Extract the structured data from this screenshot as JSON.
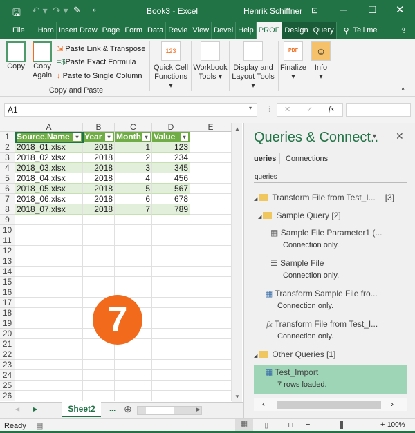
{
  "title": {
    "doc": "Book3  -  Excel",
    "user": "Henrik Schiffner"
  },
  "tabs": [
    "File",
    "Hom",
    "Insert",
    "Draw",
    "Page",
    "Form",
    "Data",
    "Revie",
    "View",
    "Devel",
    "Help",
    "PROF",
    "Design",
    "Query"
  ],
  "tell_me": "Tell me",
  "ribbon": {
    "copy": "Copy",
    "copy_again_1": "Copy",
    "copy_again_2": "Again",
    "paste_link": "Paste Link & Transpose",
    "paste_exact": "Paste Exact Formula",
    "paste_single": "Paste to Single Column",
    "group": "Copy and Paste",
    "quick1": "Quick Cell",
    "quick2": "Functions ▾",
    "wb1": "Workbook",
    "wb2": "Tools ▾",
    "disp1": "Display and",
    "disp2": "Layout Tools ▾",
    "finalize": "Finalize",
    "info": "Info",
    "pdf": "PDF",
    "quick_icon": "123"
  },
  "namebox": "A1",
  "fx": "fx",
  "grid": {
    "columns": [
      "A",
      "B",
      "C",
      "D",
      "E"
    ],
    "headers": [
      "Source.Name",
      "Year",
      "Month",
      "Value"
    ],
    "rows": [
      [
        "2018_01.xlsx",
        "2018",
        "1",
        "123"
      ],
      [
        "2018_02.xlsx",
        "2018",
        "2",
        "234"
      ],
      [
        "2018_03.xlsx",
        "2018",
        "3",
        "345"
      ],
      [
        "2018_04.xlsx",
        "2018",
        "4",
        "456"
      ],
      [
        "2018_05.xlsx",
        "2018",
        "5",
        "567"
      ],
      [
        "2018_06.xlsx",
        "2018",
        "6",
        "678"
      ],
      [
        "2018_07.xlsx",
        "2018",
        "7",
        "789"
      ]
    ],
    "row_count": 26
  },
  "badge": "7",
  "pane": {
    "title": "Queries & Connect..",
    "tab_queries": "ueries",
    "tab_connections": "Connections",
    "subheader": "queries",
    "g1": "Transform File from Test_I...",
    "g1_count": "[3]",
    "g2": "Sample Query",
    "g2_count": "[2]",
    "q1": "Sample File Parameter1 (...",
    "q1s": "Connection only.",
    "q2": "Sample File",
    "q2s": "Connection only.",
    "q3": "Transform Sample File fro...",
    "q3s": "Connection only.",
    "q4": "Transform File from Test_I...",
    "q4s": "Connection only.",
    "g3": "Other Queries",
    "g3_count": "[1]",
    "q5": "Test_Import",
    "q5s": "7 rows loaded."
  },
  "sheet": {
    "tab": "Sheet2",
    "more": "..."
  },
  "status": {
    "ready": "Ready",
    "zoom": "100%"
  },
  "colors": {
    "excel_green": "#217346",
    "table_header": "#70ad47",
    "band": "#e2efda",
    "selected_query": "#9fd5b7",
    "badge": "#f26b1d"
  }
}
